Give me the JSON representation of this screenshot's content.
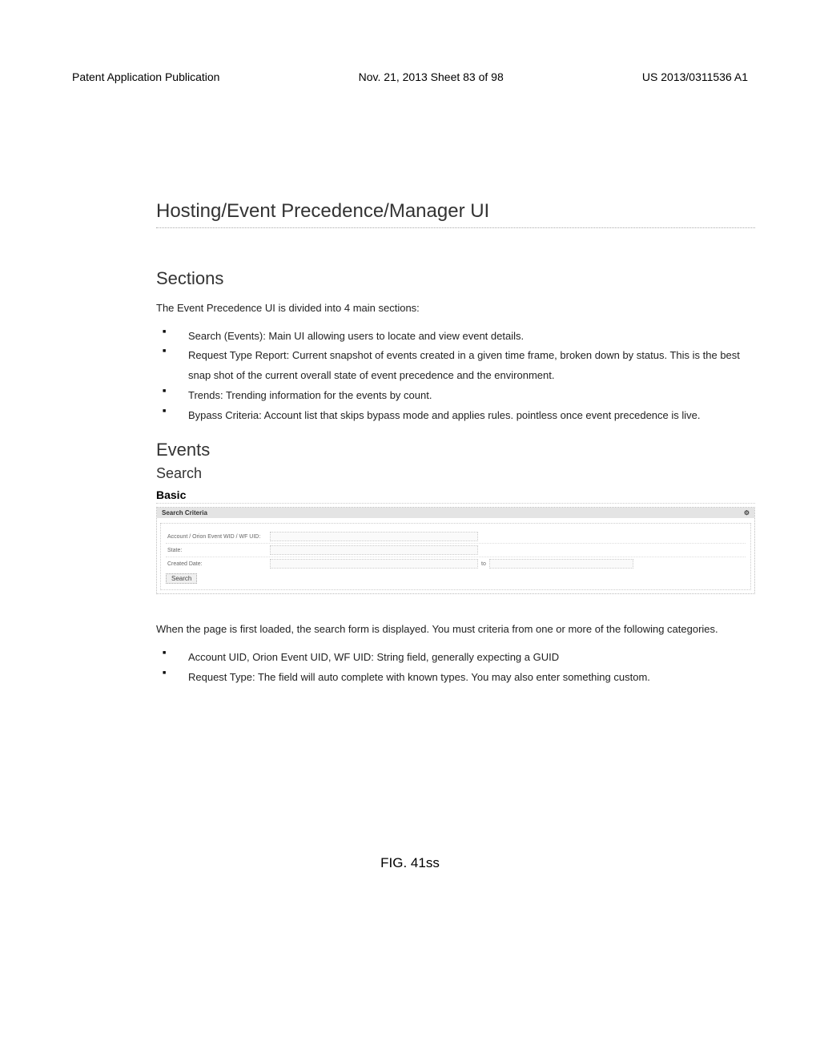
{
  "header": {
    "left": "Patent Application Publication",
    "center": "Nov. 21, 2013  Sheet 83 of 98",
    "right": "US 2013/0311536 A1"
  },
  "titles": {
    "main": "Hosting/Event Precedence/Manager UI",
    "sections": "Sections",
    "events": "Events",
    "search": "Search",
    "basic": "Basic"
  },
  "intro": "The Event Precedence UI is divided into 4 main sections:",
  "sections_list": [
    "Search (Events): Main UI allowing users to locate and view event details.",
    "Request Type Report: Current snapshot of events created in a given time frame, broken down by status. This is the best snap shot of the current overall state of event precedence and the environment.",
    "Trends: Trending information for the events by count.",
    "Bypass Criteria: Account list that skips bypass mode and applies rules. pointless once event precedence is live."
  ],
  "form": {
    "header_label": "Search Criteria",
    "rows": {
      "row1_label": "Account / Orion Event WID / WF UID:",
      "row2_label": "State:",
      "row3_label": "Created Date:",
      "to": "to"
    },
    "button": "Search"
  },
  "post_form": "When the page is first loaded, the search form is displayed. You must criteria from one or more of the following categories.",
  "criteria_list": [
    "Account UID, Orion Event UID, WF UID: String field, generally expecting a GUID",
    "Request Type: The field will auto complete with known types. You may also enter something custom."
  ],
  "figure": "FIG. 41ss"
}
